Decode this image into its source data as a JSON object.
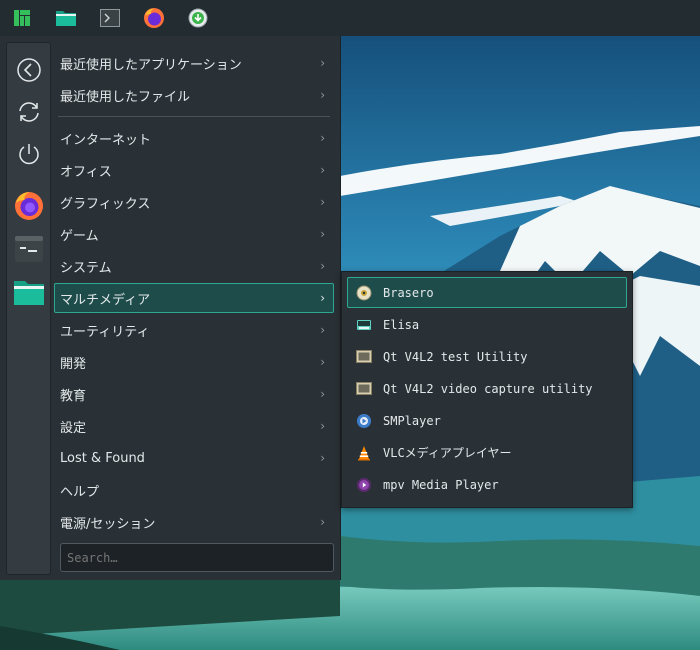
{
  "colors": {
    "accent": "#2fa893",
    "panel": "#2a3136",
    "taskbar": "#232c31"
  },
  "taskbar": {
    "items": [
      {
        "icon": "manjaro-logo-icon"
      },
      {
        "icon": "file-manager-icon"
      },
      {
        "icon": "terminal-icon"
      },
      {
        "icon": "firefox-icon"
      },
      {
        "icon": "download-manager-icon"
      }
    ]
  },
  "sidebar": {
    "buttons": [
      {
        "icon": "back-icon"
      },
      {
        "icon": "refresh-icon"
      },
      {
        "icon": "power-icon"
      },
      {
        "icon": "firefox-icon"
      },
      {
        "icon": "terminal-icon"
      },
      {
        "icon": "folder-icon"
      }
    ]
  },
  "menu": {
    "recent_apps": "最近使用したアプリケーション",
    "recent_files": "最近使用したファイル",
    "categories": [
      "インターネット",
      "オフィス",
      "グラフィックス",
      "ゲーム",
      "システム",
      "マルチメディア",
      "ユーティリティ",
      "開発",
      "教育",
      "設定",
      "Lost & Found",
      "ヘルプ",
      "電源/セッション"
    ],
    "active_category": "マルチメディア",
    "chevron": "›",
    "search_placeholder": "Search…"
  },
  "submenu": {
    "items": [
      {
        "label": "Brasero",
        "icon": "disc-burner-icon"
      },
      {
        "label": "Elisa",
        "icon": "music-player-icon"
      },
      {
        "label": "Qt V4L2 test Utility",
        "icon": "webcam-icon"
      },
      {
        "label": "Qt V4L2 video capture utility",
        "icon": "webcam-icon"
      },
      {
        "label": "SMPlayer",
        "icon": "smplayer-icon"
      },
      {
        "label": "VLCメディアプレイヤー",
        "icon": "vlc-cone-icon"
      },
      {
        "label": "mpv Media Player",
        "icon": "mpv-icon"
      }
    ]
  }
}
